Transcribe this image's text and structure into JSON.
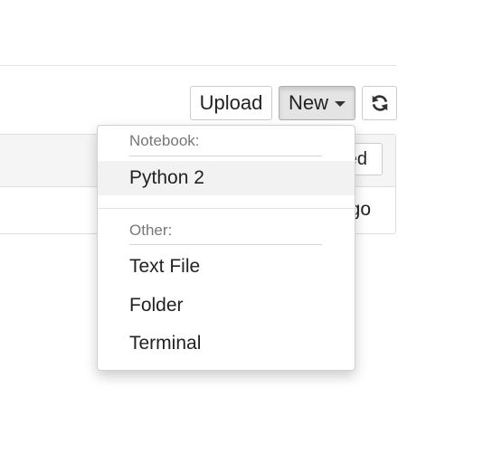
{
  "toolbar": {
    "upload_label": "Upload",
    "new_label": "New",
    "refresh_icon": "refresh-icon"
  },
  "file_list": {
    "header_button_partial": "ed",
    "row_partial_text": "go"
  },
  "new_menu": {
    "notebook_header": "Notebook:",
    "notebook_items": [
      "Python 2"
    ],
    "other_header": "Other:",
    "other_items": [
      "Text File",
      "Folder",
      "Terminal"
    ]
  },
  "colors": {
    "new_button_active_bg": "#e4e4e4",
    "menu_hover_bg": "#f2f2f2",
    "header_text": "#777777"
  }
}
